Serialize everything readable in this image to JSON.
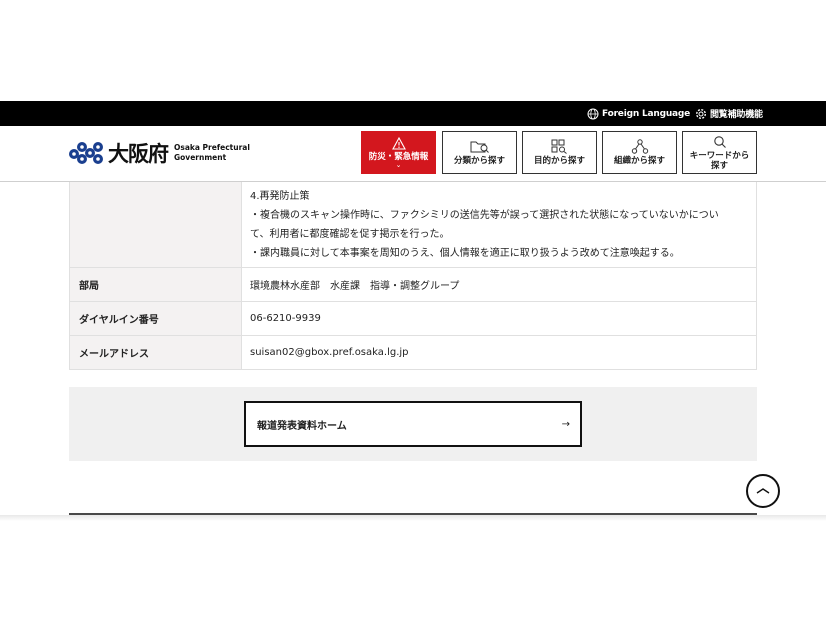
{
  "topbar": {
    "foreign_language": "Foreign Language",
    "accessibility": "閲覧補助機能"
  },
  "header": {
    "logo_jp": "大阪府",
    "logo_en_line1": "Osaka Prefectural",
    "logo_en_line2": "Government",
    "nav": [
      {
        "label": "防災・緊急情報",
        "icon": "warning-icon"
      },
      {
        "label": "分類から探す",
        "icon": "folder-search-icon"
      },
      {
        "label": "目的から探す",
        "icon": "grid-search-icon"
      },
      {
        "label": "組織から探す",
        "icon": "org-chart-icon"
      },
      {
        "label_line1": "キーワードから",
        "label_line2": "探す",
        "icon": "search-icon"
      }
    ],
    "emergency_color": "#d3171e"
  },
  "table": {
    "measures": {
      "heading": "4.再発防止策",
      "line1": "・複合機のスキャン操作時に、ファクシミリの送信先等が誤って選択された状態になっていないかについ",
      "line2": "て、利用者に都度確認を促す掲示を行った。",
      "line3": "・課内職員に対して本事案を周知のうえ、個人情報を適正に取り扱うよう改めて注意喚起する。"
    },
    "rows": [
      {
        "label": "部局",
        "value": "環境農林水産部　水産課　指導・調整グループ"
      },
      {
        "label": "ダイヤルイン番号",
        "value": "06-6210-9939"
      },
      {
        "label": "メールアドレス",
        "value": "suisan02@gbox.pref.osaka.lg.jp"
      }
    ]
  },
  "home_link": {
    "label": "報道発表資料ホーム",
    "arrow": "→"
  }
}
